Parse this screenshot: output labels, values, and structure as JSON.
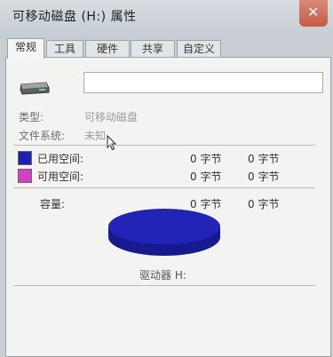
{
  "window": {
    "title": "可移动磁盘 (H:) 属性",
    "close_glyph": "✕"
  },
  "tabs": [
    {
      "label": "常规",
      "active": true
    },
    {
      "label": "工具",
      "active": false
    },
    {
      "label": "硬件",
      "active": false
    },
    {
      "label": "共享",
      "active": false
    },
    {
      "label": "自定义",
      "active": false
    }
  ],
  "general": {
    "name_field_value": "",
    "type_label": "类型:",
    "type_value": "可移动磁盘",
    "filesystem_label": "文件系统:",
    "filesystem_value": "未知",
    "used_label": "已用空间:",
    "used_bytes": "0 字节",
    "used_size": "0 字节",
    "free_label": "可用空间:",
    "free_bytes": "0 字节",
    "free_size": "0 字节",
    "capacity_label": "容量:",
    "capacity_bytes": "0 字节",
    "capacity_size": "0 字节",
    "drive_label": "驱动器 H:"
  },
  "colors": {
    "used": "#1f1fb5",
    "free": "#d43fc8",
    "disk": "#2224b8"
  }
}
